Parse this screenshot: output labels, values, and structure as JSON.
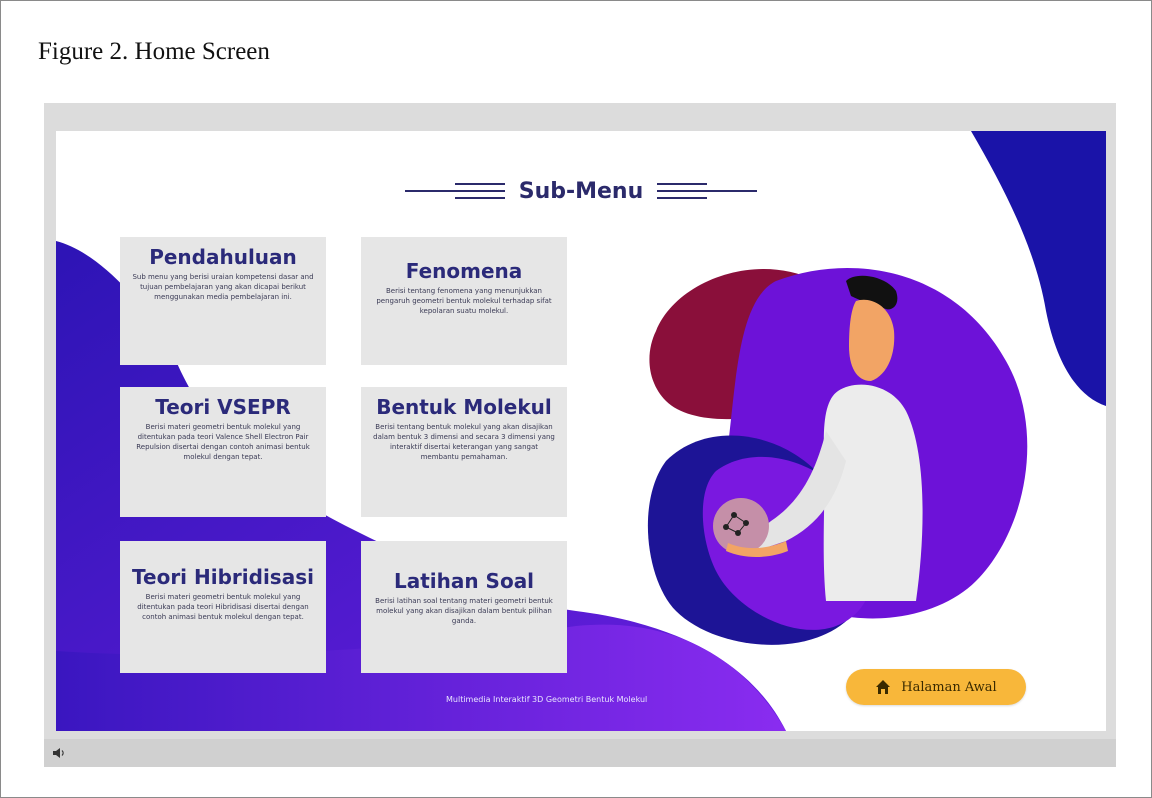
{
  "figure_caption": "Figure 2. Home Screen",
  "header": {
    "title": "Sub-Menu"
  },
  "cards": [
    {
      "title": "Pendahuluan",
      "desc": "Sub menu yang berisi uraian kompetensi dasar and tujuan pembelajaran yang akan dicapai berikut menggunakan media pembelajaran ini."
    },
    {
      "title": "Fenomena",
      "desc": "Berisi tentang fenomena yang menunjukkan pengaruh geometri bentuk molekul terhadap sifat kepolaran suatu molekul."
    },
    {
      "title": "Teori VSEPR",
      "desc": "Berisi materi geometri bentuk molekul yang ditentukan pada teori Valence Shell Electron Pair Repulsion disertai dengan contoh animasi bentuk molekul dengan tepat."
    },
    {
      "title": "Bentuk Molekul",
      "desc": "Berisi tentang bentuk molekul yang akan disajikan dalam bentuk 3 dimensi and secara 3 dimensi yang interaktif disertai keterangan yang sangat membantu pemahaman."
    },
    {
      "title": "Teori Hibridisasi",
      "desc": "Berisi materi geometri bentuk molekul yang ditentukan pada teori Hibridisasi disertai dengan contoh animasi bentuk molekul dengan tepat."
    },
    {
      "title": "Latihan Soal",
      "desc": "Berisi latihan soal tentang materi geometri bentuk molekul yang akan disajikan dalam bentuk pilihan ganda."
    }
  ],
  "footer": {
    "text": "Multimedia Interaktif 3D Geometri Bentuk Molekul"
  },
  "home_button": {
    "label": "Halaman Awal",
    "icon": "home-icon"
  },
  "colors": {
    "navy": "#1a13a8",
    "purple": "#6d12d8",
    "maroon": "#8a0f3a",
    "title": "#2b2a6b",
    "button": "#f8b73a"
  }
}
